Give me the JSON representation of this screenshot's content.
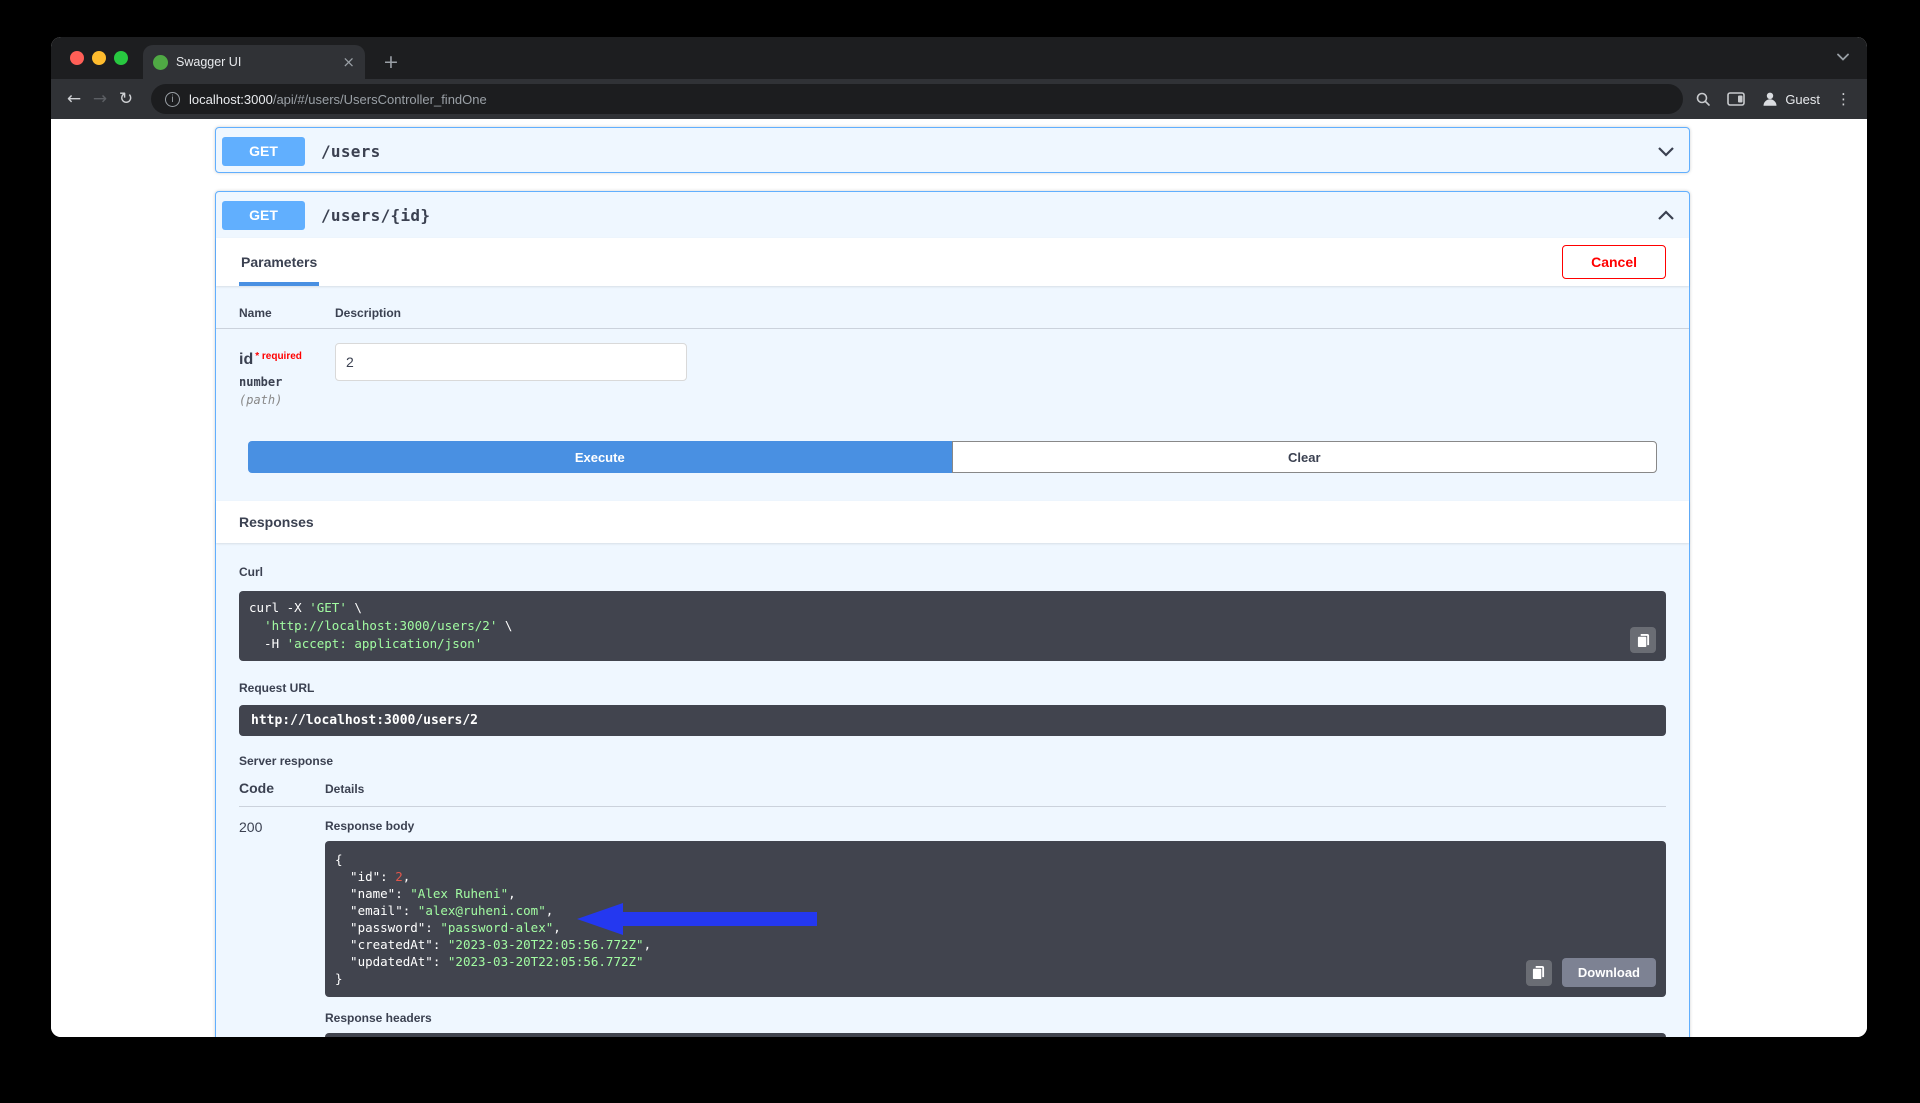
{
  "window": {
    "tab_title": "Swagger UI",
    "url_host": "localhost:3000",
    "url_path": "/api/#/users/UsersController_findOne",
    "profile_label": "Guest"
  },
  "opblocks": {
    "users_list": {
      "method": "GET",
      "path": "/users"
    },
    "users_by_id": {
      "method": "GET",
      "path": "/users/{id}"
    }
  },
  "parameters": {
    "tab_label": "Parameters",
    "cancel_label": "Cancel",
    "columns": {
      "name": "Name",
      "description": "Description"
    },
    "rows": [
      {
        "name": "id",
        "required": "* required",
        "type": "number",
        "in": "(path)",
        "value": "2"
      }
    ],
    "execute_label": "Execute",
    "clear_label": "Clear"
  },
  "responses": {
    "section_title": "Responses",
    "curl_label": "Curl",
    "curl_lines": [
      [
        {
          "t": "curl -X ",
          "c": "p"
        },
        {
          "t": "'GET'",
          "c": "s"
        },
        {
          "t": " \\",
          "c": "p"
        }
      ],
      [
        {
          "t": "  ",
          "c": "p"
        },
        {
          "t": "'http://localhost:3000/users/2'",
          "c": "s"
        },
        {
          "t": " \\",
          "c": "p"
        }
      ],
      [
        {
          "t": "  -H ",
          "c": "p"
        },
        {
          "t": "'accept: application/json'",
          "c": "s"
        }
      ]
    ],
    "request_url_label": "Request URL",
    "request_url": "http://localhost:3000/users/2",
    "server_response_label": "Server response",
    "columns": {
      "code": "Code",
      "details": "Details"
    },
    "status_code": "200",
    "response_body_label": "Response body",
    "body_lines": [
      [
        {
          "t": "{",
          "c": "p"
        }
      ],
      [
        {
          "t": "  \"id\": ",
          "c": "p"
        },
        {
          "t": "2",
          "c": "n"
        },
        {
          "t": ",",
          "c": "p"
        }
      ],
      [
        {
          "t": "  \"name\": ",
          "c": "p"
        },
        {
          "t": "\"Alex Ruheni\"",
          "c": "s"
        },
        {
          "t": ",",
          "c": "p"
        }
      ],
      [
        {
          "t": "  \"email\": ",
          "c": "p"
        },
        {
          "t": "\"alex@ruheni.com\"",
          "c": "s"
        },
        {
          "t": ",",
          "c": "p"
        }
      ],
      [
        {
          "t": "  \"password\": ",
          "c": "p"
        },
        {
          "t": "\"password-alex\"",
          "c": "s"
        },
        {
          "t": ",",
          "c": "p"
        }
      ],
      [
        {
          "t": "  \"createdAt\": ",
          "c": "p"
        },
        {
          "t": "\"2023-03-20T22:05:56.772Z\"",
          "c": "s"
        },
        {
          "t": ",",
          "c": "p"
        }
      ],
      [
        {
          "t": "  \"updatedAt\": ",
          "c": "p"
        },
        {
          "t": "\"2023-03-20T22:05:56.772Z\"",
          "c": "s"
        }
      ],
      [
        {
          "t": "}",
          "c": "p"
        }
      ]
    ],
    "download_label": "Download",
    "response_headers_label": "Response headers"
  },
  "colors": {
    "get_badge": "#61affe",
    "opblock_bg": "#eff7ff",
    "execute_button": "#4990e2",
    "cancel_border": "#ff0000",
    "code_block_bg": "#41444e",
    "string_token": "#a2fca2",
    "number_token": "#e0564b",
    "download_button": "#7d8293",
    "annotation_arrow": "#2438f0"
  }
}
